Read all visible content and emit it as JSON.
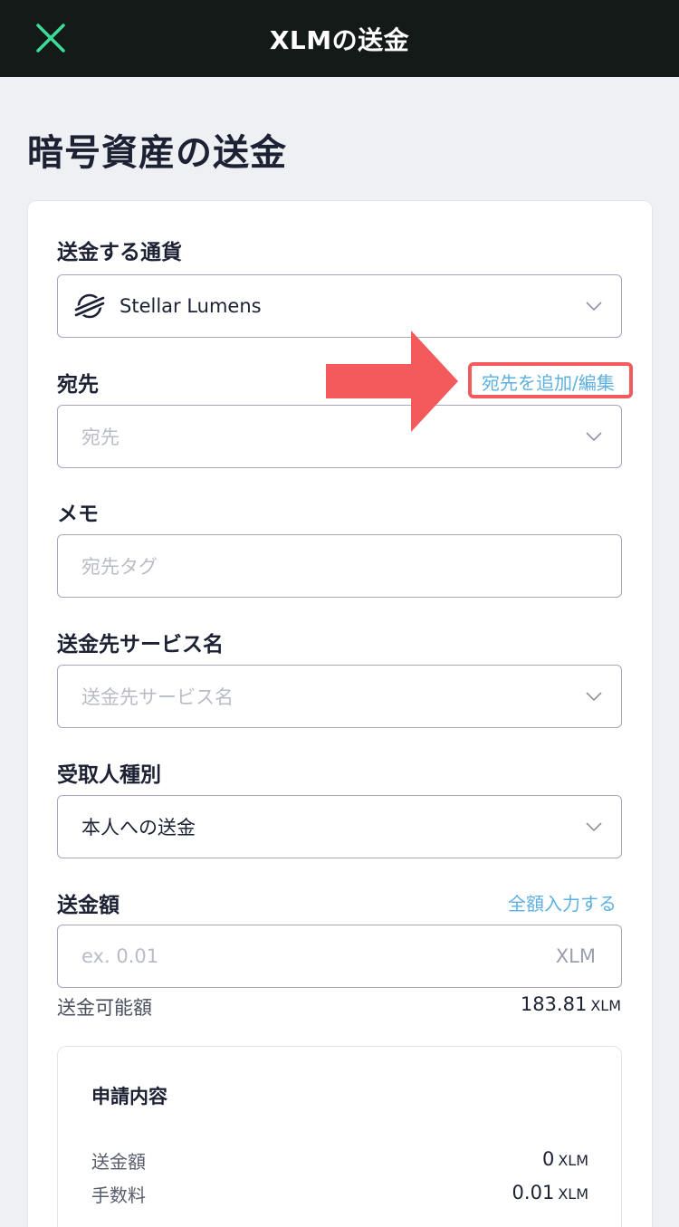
{
  "header": {
    "title": "XLMの送金",
    "close_icon": "close-icon",
    "accent": "#3ddc97",
    "background": "#141a18"
  },
  "page": {
    "title": "暗号資産の送金"
  },
  "form": {
    "currency": {
      "label": "送金する通貨",
      "value": "Stellar Lumens",
      "icon": "stellar-logo-icon"
    },
    "destination": {
      "label": "宛先",
      "placeholder": "宛先",
      "edit_link": "宛先を追加/編集"
    },
    "memo": {
      "label": "メモ",
      "placeholder": "宛先タグ"
    },
    "service": {
      "label": "送金先サービス名",
      "placeholder": "送金先サービス名"
    },
    "recipient_type": {
      "label": "受取人種別",
      "value": "本人への送金"
    },
    "amount": {
      "label": "送金額",
      "fill_all_link": "全額入力する",
      "placeholder": "ex. 0.01",
      "unit": "XLM"
    },
    "available": {
      "label": "送金可能額",
      "value": "183.81",
      "unit": "XLM"
    }
  },
  "summary": {
    "title": "申請内容",
    "rows": [
      {
        "label": "送金額",
        "value": "0",
        "unit": "XLM"
      },
      {
        "label": "手数料",
        "value": "0.01",
        "unit": "XLM"
      }
    ]
  },
  "annotation": {
    "color": "#f25a5c"
  }
}
